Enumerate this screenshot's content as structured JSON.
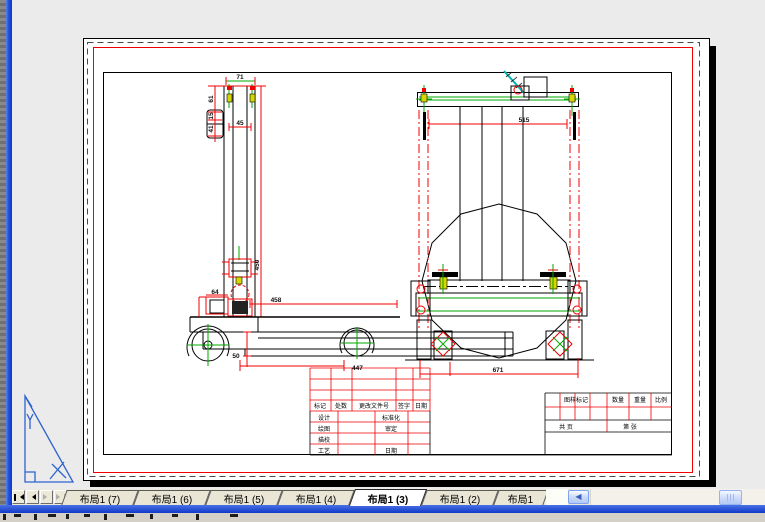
{
  "colors": {
    "cad_red": "#f00000",
    "cad_green": "#00a800",
    "cad_cyan": "#00b4b4",
    "cad_yellow": "#d6d600",
    "xp_border_blue": "#2050dc",
    "paper_white": "#ffffff",
    "canvas_gray": "#ebebeb"
  },
  "dims": {
    "d71": "71",
    "d45": "45",
    "d61": "61",
    "d15": "15",
    "d41": "41",
    "d450": "450",
    "d64": "64",
    "d458": "458",
    "d50": "50",
    "d447": "447",
    "d515": "515",
    "d671": "671"
  },
  "title_block": {
    "rev_header": [
      "标记",
      "处数",
      "更改文件号",
      "签字",
      "日期"
    ],
    "proc_rows": [
      {
        "left": "设计",
        "right": "标准化"
      },
      {
        "left": "绘图",
        "right": "审定"
      },
      {
        "left": "描校",
        "right": ""
      },
      {
        "left": "工艺",
        "right": "日期"
      }
    ],
    "stamp_header": [
      "图样标记",
      "数量",
      "重量",
      "比例"
    ],
    "pages": [
      "共  页",
      "第  张"
    ]
  },
  "tabs": {
    "items": [
      {
        "label": "布局1 (7)",
        "active": false
      },
      {
        "label": "布局1 (6)",
        "active": false
      },
      {
        "label": "布局1 (5)",
        "active": false
      },
      {
        "label": "布局1 (4)",
        "active": false
      },
      {
        "label": "布局1 (3)",
        "active": true
      },
      {
        "label": "布局1 (2)",
        "active": false
      },
      {
        "label": "布局1",
        "active": false
      }
    ]
  },
  "icons": {
    "tab_scroll_left": "◀"
  }
}
